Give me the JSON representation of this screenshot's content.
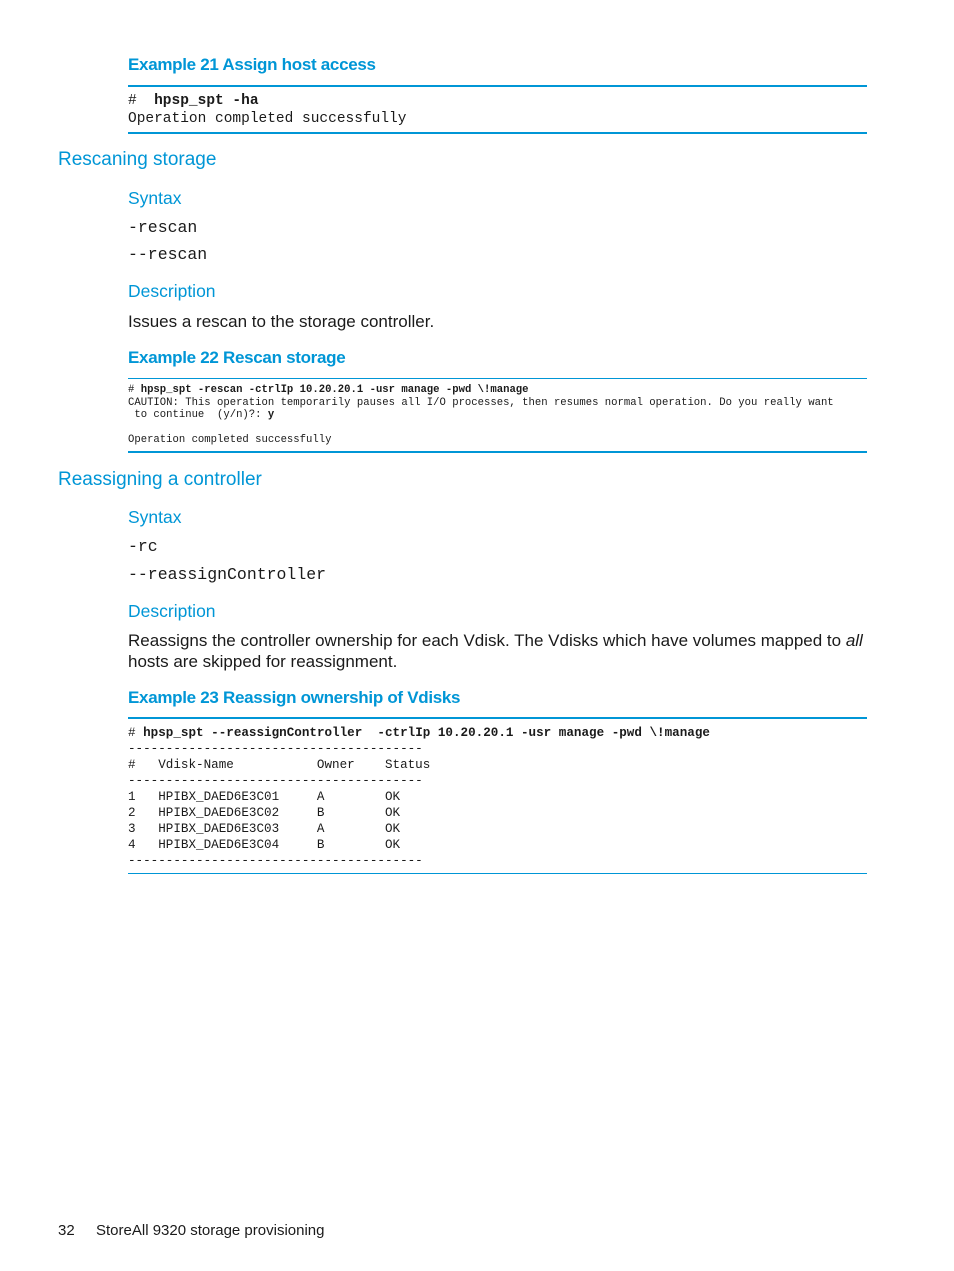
{
  "example21": {
    "title": "Example 21 Assign host access",
    "prompt": "#  ",
    "command": "hpsp_spt -ha",
    "output": "Operation completed successfully"
  },
  "rescan": {
    "section_title": "Rescaning storage",
    "syntax_heading": "Syntax",
    "syntax": [
      "-rescan",
      "--rescan"
    ],
    "description_heading": "Description",
    "description": "Issues a rescan to the storage controller."
  },
  "example22": {
    "title": "Example 22 Rescan storage",
    "prompt": "# ",
    "command": "hpsp_spt -rescan -ctrlIp 10.20.20.1 -usr manage -pwd \\!manage",
    "caution_line1": "CAUTION: This operation temporarily pauses all I/O processes, then resumes normal operation. Do you really want",
    "caution_line2": " to continue  (y/n)?: ",
    "answer": "y",
    "output": "Operation completed successfully"
  },
  "reassign": {
    "section_title": "Reassigning a controller",
    "syntax_heading": "Syntax",
    "syntax": [
      "-rc",
      "--reassignController"
    ],
    "description_heading": "Description",
    "description_before": "Reassigns the controller ownership for each Vdisk. The Vdisks which have volumes mapped to ",
    "description_italic": "all",
    "description_after": " hosts are skipped for reassignment."
  },
  "example23": {
    "title": "Example 23 Reassign ownership of Vdisks",
    "prompt": "# ",
    "command": "hpsp_spt --reassignController  -ctrlIp 10.20.20.1 -usr manage -pwd \\!manage",
    "separator": "---------------------------------------",
    "header": "#   Vdisk-Name           Owner    Status",
    "rows": [
      "1   HPIBX_DAED6E3C01     A        OK",
      "2   HPIBX_DAED6E3C02     B        OK",
      "3   HPIBX_DAED6E3C03     A        OK",
      "4   HPIBX_DAED6E3C04     B        OK"
    ]
  },
  "footer": {
    "page_number": "32",
    "chapter": "StoreAll 9320 storage provisioning"
  },
  "colors": {
    "accent": "#0096d6",
    "text": "#1a1a1a"
  }
}
